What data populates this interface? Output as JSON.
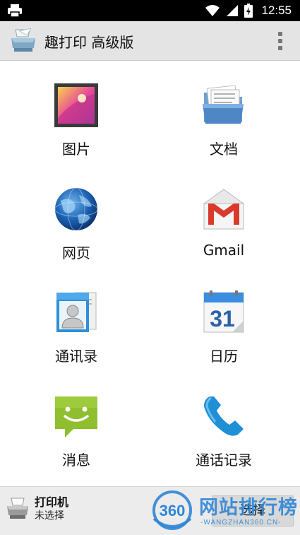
{
  "status_bar": {
    "time": "12:55",
    "icons": [
      "print-icon",
      "wifi-icon",
      "signal-icon",
      "battery-charging-icon"
    ]
  },
  "app_bar": {
    "title": "趣打印 高级版",
    "menu_icon": "overflow-menu-icon"
  },
  "tiles": [
    {
      "label": "图片",
      "icon": "pictures-icon"
    },
    {
      "label": "文档",
      "icon": "documents-folder-icon"
    },
    {
      "label": "网页",
      "icon": "web-globe-icon"
    },
    {
      "label": "Gmail",
      "icon": "gmail-icon"
    },
    {
      "label": "通讯录",
      "icon": "contacts-icon"
    },
    {
      "label": "日历",
      "icon": "calendar-icon"
    },
    {
      "label": "消息",
      "icon": "messages-icon"
    },
    {
      "label": "通话记录",
      "icon": "call-log-icon"
    }
  ],
  "calendar_day": "31",
  "bottom_bar": {
    "printer_label": "打印机",
    "printer_status": "未选择",
    "select_button": "选择"
  },
  "watermark": {
    "badge": "360",
    "title": "网站排行榜",
    "subtitle": "-WANGZHAN360.CN-"
  }
}
